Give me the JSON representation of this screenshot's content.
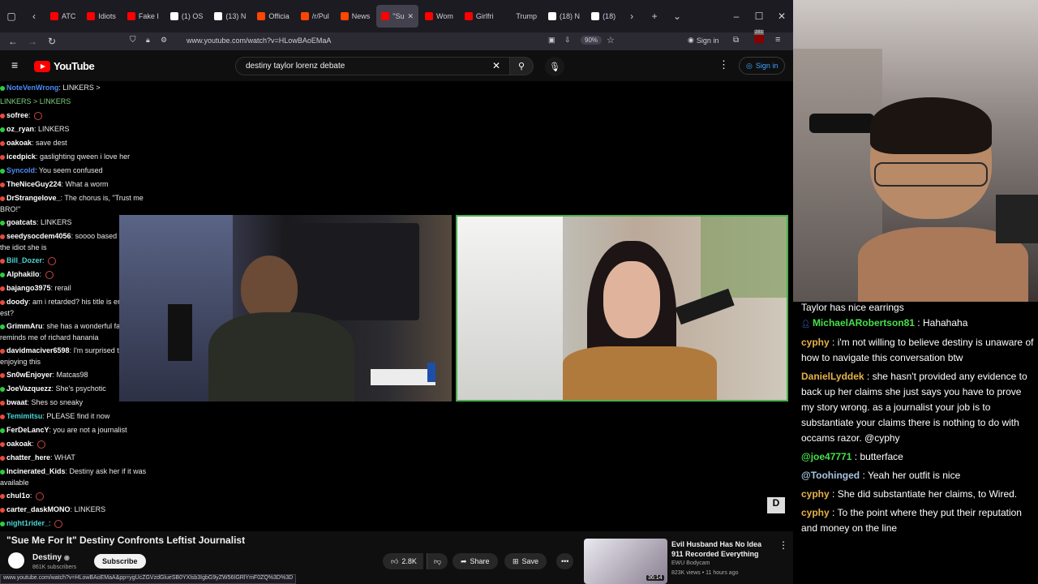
{
  "browser": {
    "tabs": [
      {
        "label": "ATC",
        "color": "#ff0000"
      },
      {
        "label": "Idiots",
        "color": "#ff0000"
      },
      {
        "label": "Fake I",
        "color": "#ff0000"
      },
      {
        "label": "(1) OS",
        "color": "#ffffff"
      },
      {
        "label": "(13) N",
        "color": "#ffffff"
      },
      {
        "label": "Officia",
        "color": "#ff4500"
      },
      {
        "label": "/r/Pul",
        "color": "#ff4500"
      },
      {
        "label": "News",
        "color": "#ff4500"
      },
      {
        "label": "\"Su",
        "color": "#ff0000",
        "active": true
      },
      {
        "label": "Wom",
        "color": "#ff0000"
      },
      {
        "label": "Girlfri",
        "color": "#ff0000"
      },
      {
        "label": "Trump",
        "color": "#1c1b22"
      },
      {
        "label": "(18) N",
        "color": "#ffffff"
      },
      {
        "label": "(18)",
        "color": "#ffffff"
      }
    ],
    "url": "www.youtube.com/watch?v=HLowBAoEMaA",
    "zoom": "90%",
    "sign_in": "Sign in",
    "badge": "281",
    "status_url": "www.youtube.com/watch?v=HLowBAoEMaA&pp=ygUcZGVzdGlueSB0YXlsb3IgbG9yZW56IGRlYmF0ZQ%3D%3D"
  },
  "youtube": {
    "logo": "YouTube",
    "search_query": "destiny taylor lorenz debate",
    "sign_in": "Sign in"
  },
  "video_chat": [
    {
      "user": "NoteVenWrong",
      "text": "LINKERS >",
      "ucolor": "#4c8bf5"
    },
    {
      "user": "",
      "text": "LINKERS > LINKERS",
      "ucolor": "#7fd17f",
      "plain": true
    },
    {
      "user": "sofree",
      "text": "",
      "ucolor": "#ffffff"
    },
    {
      "user": "oz_ryan",
      "text": "LINKERS",
      "ucolor": "#ffffff"
    },
    {
      "user": "oakoak",
      "text": "save dest",
      "ucolor": "#ffffff"
    },
    {
      "user": "icedpick",
      "text": "gaslighting qween i love her",
      "ucolor": "#ffffff"
    },
    {
      "user": "Syncold",
      "text": "You seem confused",
      "ucolor": "#4c8bf5"
    },
    {
      "user": "TheNiceGuy224",
      "text": "What a worm",
      "ucolor": "#ffffff"
    },
    {
      "user": "DrStrangelove_",
      "text": "The chorus is, \"Trust me BRO!\"",
      "ucolor": "#ffffff",
      "wrap": true
    },
    {
      "user": "goatcats",
      "text": "LINKERS",
      "ucolor": "#ffffff"
    },
    {
      "user": "seedysocdem4056",
      "text": "soooo based treat her like the idiot she is",
      "ucolor": "#ffffff",
      "wrap": true
    },
    {
      "user": "Bill_Dozer",
      "text": "",
      "ucolor": "#4cd4d4"
    },
    {
      "user": "Alphakilo",
      "text": "",
      "ucolor": "#ffffff"
    },
    {
      "user": "bajango3975",
      "text": "rerail",
      "ucolor": "#ffffff"
    },
    {
      "user": "doody",
      "text": "am i retarded? his title is ending at 5 pm est?",
      "ucolor": "#ffffff",
      "wrap": true
    },
    {
      "user": "GrimmAru",
      "text": "she has a wonderful face, it reminds me of richard hanania",
      "ucolor": "#ffffff",
      "wrap": true
    },
    {
      "user": "davidmaciver6598",
      "text": "I'm surprised that Taylor is enjoying this",
      "ucolor": "#ffffff",
      "wrap": true
    },
    {
      "user": "Sn0wEnjoyer",
      "text": "Matcas98",
      "ucolor": "#ffffff"
    },
    {
      "user": "JoeVazquezz",
      "text": "She's psychotic",
      "ucolor": "#ffffff"
    },
    {
      "user": "bwaat",
      "text": "Shes so sneaky",
      "ucolor": "#ffffff"
    },
    {
      "user": "Temimitsu",
      "text": "PLEASE find it now",
      "ucolor": "#4cd4d4"
    },
    {
      "user": "FerDeLancY",
      "text": "you are not a journalist",
      "ucolor": "#ffffff"
    },
    {
      "user": "oakoak",
      "text": "",
      "ucolor": "#ffffff"
    },
    {
      "user": "chatter_here",
      "text": "WHAT",
      "ucolor": "#ffffff"
    },
    {
      "user": "Incinerated_Kids",
      "text": "Destiny ask her if it was available",
      "ucolor": "#ffffff",
      "wrap": true
    },
    {
      "user": "chul1o",
      "text": "",
      "ucolor": "#ffffff"
    },
    {
      "user": "carter_daskMONO",
      "text": "LINKERS",
      "ucolor": "#ffffff"
    },
    {
      "user": "night1rider_",
      "text": "",
      "ucolor": "#4cd4d4"
    }
  ],
  "video": {
    "title": "\"Sue Me For It\" Destiny Confronts Leftist Journalist",
    "channel": "Destiny",
    "subscribers": "861K subscribers",
    "subscribe": "Subscribe",
    "likes": "2.8K",
    "share": "Share",
    "save": "Save"
  },
  "recommended": {
    "title": "Evil Husband Has No Idea 911 Recorded Everything",
    "channel": "EWU Bodycam",
    "meta": "823K views • 11 hours ago",
    "duration": "36:14"
  },
  "stream_chat": {
    "partial": "Taylor has nice earrings",
    "messages": [
      {
        "user": "MichaelARobertson81",
        "text": "Hahahaha",
        "color": "#46e04a",
        "badge": true
      },
      {
        "user": "cyphy",
        "text": "i'm not willing to believe destiny is unaware of how to navigate this conversation btw",
        "color": "#e6b24a"
      },
      {
        "user": "DanielLyddek",
        "text": "she hasn't provided any evidence to back up her claims she just says you have to prove my story wrong. as a journalist your job is to substantiate your claims there is nothing to do with occams razor. @cyphy",
        "color": "#e6b24a"
      },
      {
        "user": "@joe47771",
        "text": "butterface",
        "color": "#46e04a"
      },
      {
        "user": "@Toohinged",
        "text": "Yeah her outfit is nice",
        "color": "#a8c4e0"
      },
      {
        "user": "cyphy",
        "text": "She did substantiate her claims, to Wired.",
        "color": "#e6b24a"
      },
      {
        "user": "cyphy",
        "text": "To the point where they put their reputation and money on the line",
        "color": "#e6b24a"
      }
    ]
  }
}
